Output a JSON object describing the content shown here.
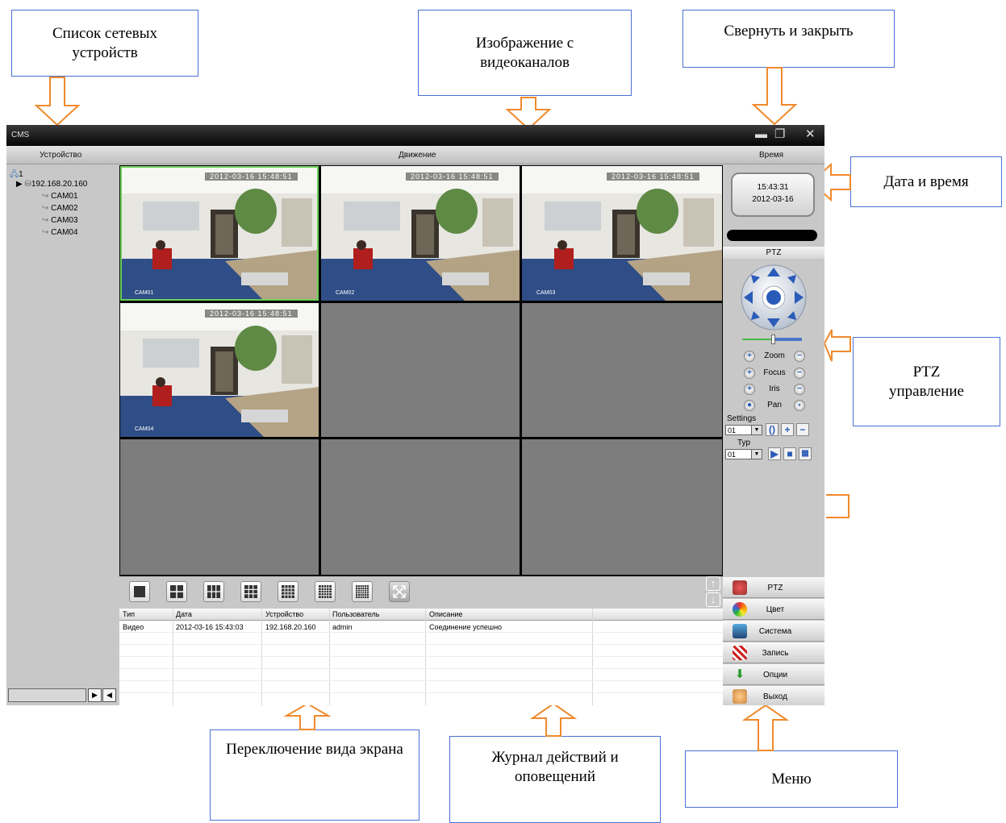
{
  "callouts": {
    "devices": "Список сетевых устройств",
    "video": "Изображение с видеоканалов",
    "minimize_close": "Свернуть и закрыть",
    "datetime": "Дата и время",
    "ptz": "PTZ управление",
    "layout": "Переключение вида экрана",
    "log": "Журнал действий и оповещений",
    "menu": "Меню"
  },
  "app": {
    "title": "CMS",
    "menu": {
      "device": "Устройство",
      "motion": "Движение",
      "time": "Время"
    }
  },
  "tree": {
    "root": "1",
    "device": "192.168.20.160",
    "cameras": [
      "CAM01",
      "CAM02",
      "CAM03",
      "CAM04"
    ]
  },
  "video": {
    "timestamp": "2012-03-16 15:48:51",
    "labels": [
      "CAM01",
      "CAM02",
      "CAM03",
      "CAM04"
    ]
  },
  "clock": {
    "time": "15:43:31",
    "date": "2012-03-16"
  },
  "ptz": {
    "header": "PTZ",
    "zoom": "Zoom",
    "focus": "Focus",
    "iris": "Iris",
    "pan": "Pan",
    "settings_label": "Settings",
    "settings_value": "01",
    "typ_label": "Typ",
    "typ_value": "01"
  },
  "log": {
    "headers": [
      "Тип",
      "Дата",
      "Устройство",
      "Пользователь",
      "Описание"
    ],
    "rows": [
      [
        "Видео",
        "2012-03-16 15:43:03",
        "192.168.20.160",
        "admin",
        "Соединение успешно"
      ]
    ]
  },
  "menu_items": [
    "PTZ",
    "Цвет",
    "Система",
    "Запись",
    "Опции",
    "Выход"
  ],
  "colors": {
    "selection": "#6cd05a",
    "annotation_arrow": "#f08a2c",
    "callout_border": "#4a6fd6",
    "ptz_blue": "#2a5bb8"
  }
}
